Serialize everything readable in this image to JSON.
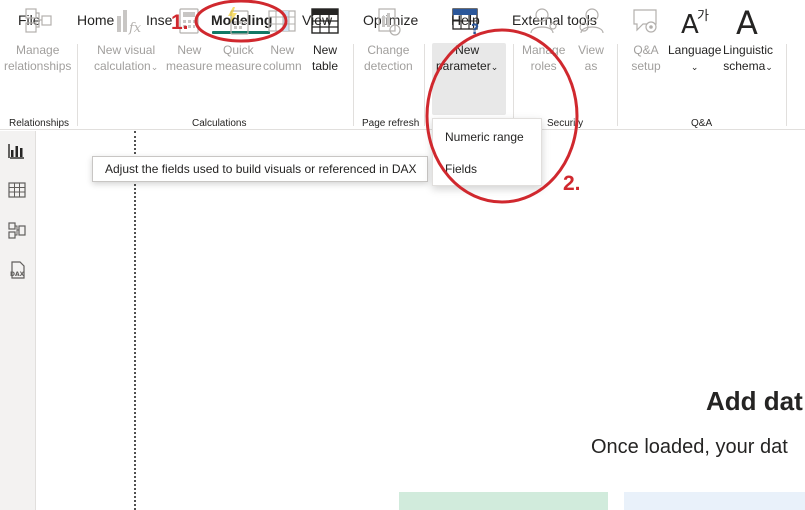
{
  "tabs": [
    {
      "label": "File"
    },
    {
      "label": "Home"
    },
    {
      "label": "Insert"
    },
    {
      "label": "Modeling"
    },
    {
      "label": "View"
    },
    {
      "label": "Optimize"
    },
    {
      "label": "Help"
    },
    {
      "label": "External tools"
    }
  ],
  "ribbon": {
    "manage_relationships": {
      "line1": "Manage",
      "line2": "relationships"
    },
    "new_visual_calc": {
      "line1": "New visual",
      "line2": "calculation"
    },
    "new_measure": {
      "line1": "New",
      "line2": "measure"
    },
    "quick_measure": {
      "line1": "Quick",
      "line2": "measure"
    },
    "new_column": {
      "line1": "New",
      "line2": "column"
    },
    "new_table": {
      "line1": "New",
      "line2": "table"
    },
    "change_detection": {
      "line1": "Change",
      "line2": "detection"
    },
    "new_parameter": {
      "line1": "New",
      "line2": "parameter"
    },
    "manage_roles": {
      "line1": "Manage",
      "line2": "roles"
    },
    "view_as": {
      "line1": "View",
      "line2": "as"
    },
    "qa_setup": {
      "line1": "Q&A",
      "line2": "setup"
    },
    "language": {
      "line1": "Language"
    },
    "linguistic_schema": {
      "line1": "Linguistic",
      "line2": "schema"
    },
    "groups": {
      "relationships": "Relationships",
      "calculations": "Calculations",
      "page_refresh": "Page refresh",
      "security": "Security",
      "qa": "Q&A"
    }
  },
  "tooltip": "Adjust the fields used to build visuals or referenced in DAX",
  "dropdown": {
    "items": [
      "Numeric range",
      "Fields"
    ]
  },
  "canvas": {
    "title": "Add dat",
    "subtitle": "Once loaded, your dat"
  },
  "annotations": {
    "step1": "1.",
    "step2": "2.",
    "color": "#d0282e"
  },
  "colors": {
    "accent": "#117865",
    "disabled_text": "#a19f9d",
    "rail_bg": "#f3f2f1"
  }
}
